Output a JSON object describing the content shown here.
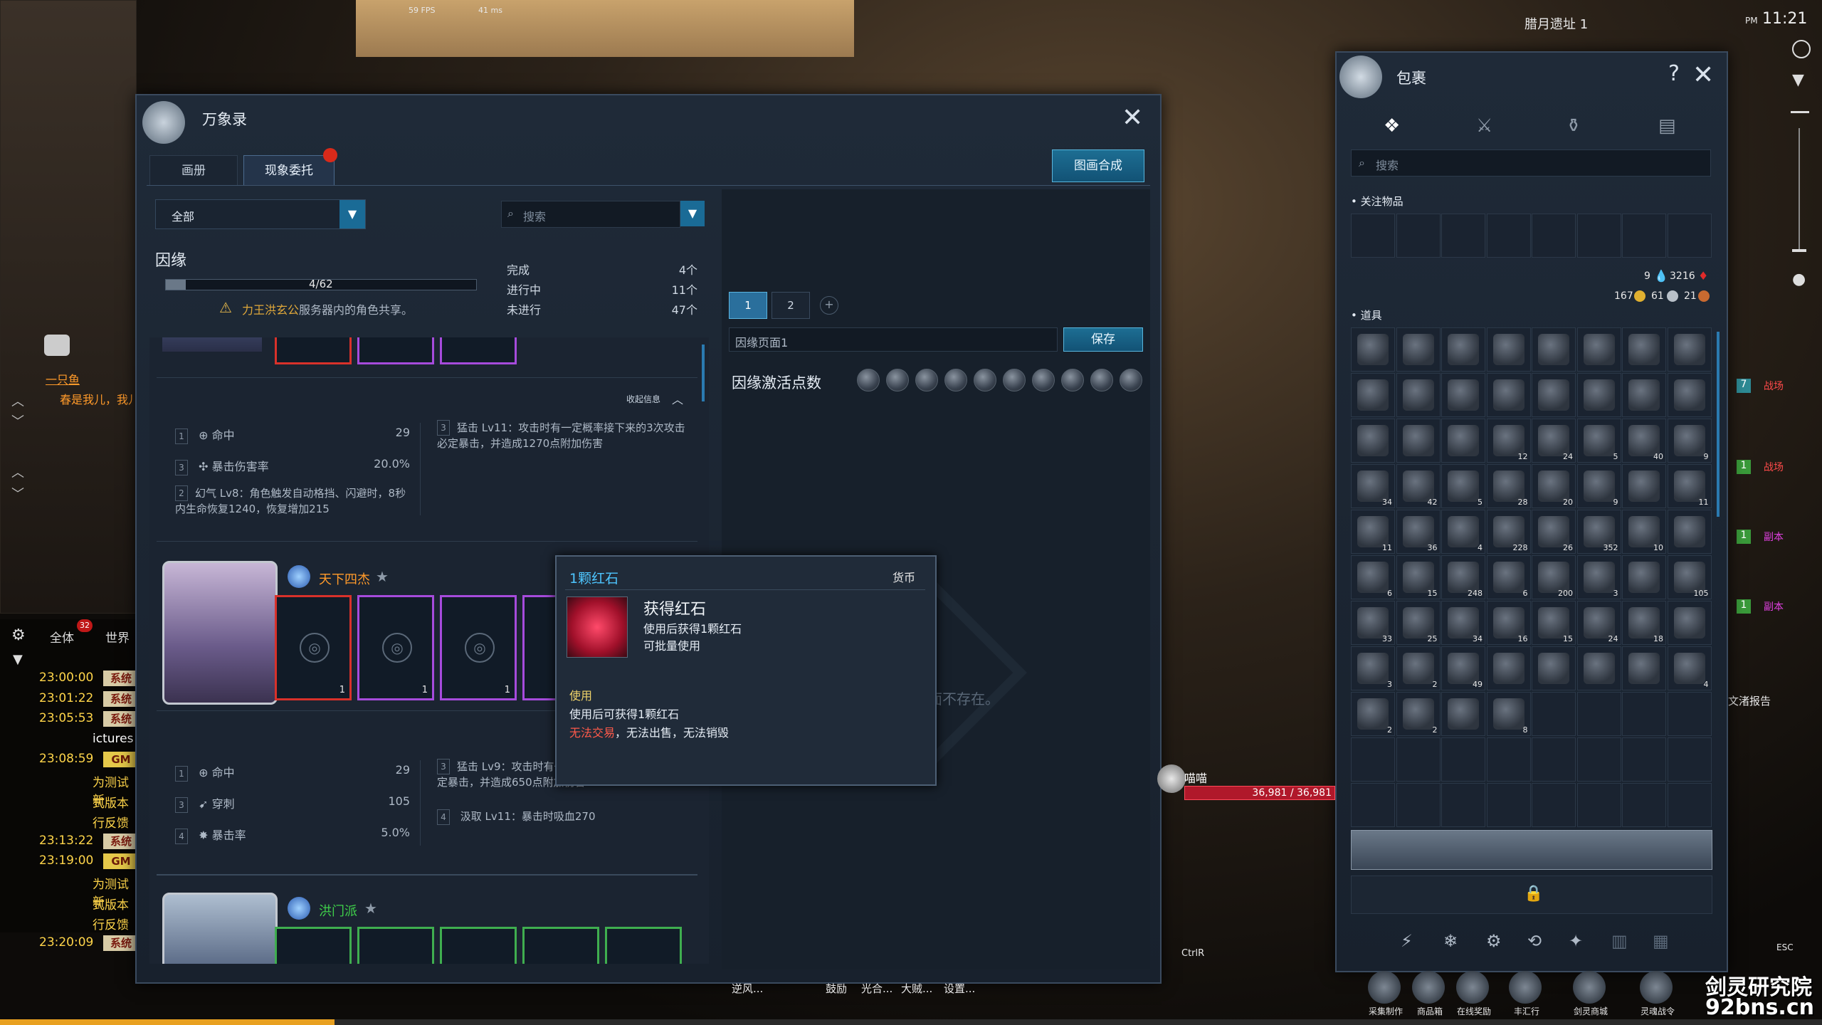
{
  "hud": {
    "fps": "59 FPS",
    "ping": "41 ms",
    "location": "腊月遗址 1",
    "time_prefix": "PM",
    "time": "11:21",
    "player_name": "喵喵",
    "hp": "36,981 / 36,981",
    "ctrl_hint": "CtrlR",
    "esc_hint": "ESC",
    "report_text": "文渚报告",
    "watermark": "剑灵研究院",
    "watermark_url": "92bns.cn",
    "right_zone_labels": [
      "战场",
      "战场",
      "副本",
      "副本"
    ],
    "right_zone_counts": [
      "7",
      "1",
      "1",
      "1"
    ],
    "left_name": "一只鱼",
    "left_msg": "春是我儿，我儿"
  },
  "chat": {
    "tabs": [
      "全体",
      "世界"
    ],
    "badge": "32",
    "rows": [
      {
        "time": "23:00:00",
        "tag": "系统"
      },
      {
        "time": "23:01:22",
        "tag": "系统"
      },
      {
        "time": "23:05:53",
        "tag": "系统"
      },
      {
        "time": "",
        "tag": "",
        "text": "ictures"
      },
      {
        "time": "23:08:59",
        "tag": "GM"
      },
      {
        "time": "",
        "tag": "",
        "text": "为测试新"
      },
      {
        "time": "",
        "tag": "",
        "text": "式版本"
      },
      {
        "time": "",
        "tag": "",
        "text": "行反馈"
      },
      {
        "time": "23:13:22",
        "tag": "系统"
      },
      {
        "time": "23:19:00",
        "tag": "GM"
      },
      {
        "time": "",
        "tag": "",
        "text": "为测试新"
      },
      {
        "time": "",
        "tag": "",
        "text": "式版本"
      },
      {
        "time": "",
        "tag": "",
        "text": "行反馈"
      },
      {
        "time": "23:20:09",
        "tag": "系统"
      }
    ]
  },
  "wanxiang": {
    "title": "万象录",
    "tabs": [
      "画册",
      "现象委托"
    ],
    "merge_button": "图画合成",
    "filter_value": "全部",
    "search_placeholder": "搜索",
    "section_title": "因缘",
    "progress": "4/62",
    "progress_fraction": 0.065,
    "warn_name": "力王洪玄公",
    "warn_suffix": "服务器内的角色共享。",
    "legend": [
      {
        "label": "完成",
        "count": "4个"
      },
      {
        "label": "进行中",
        "count": "11个"
      },
      {
        "label": "未进行",
        "count": "47个"
      }
    ],
    "collapse_label": "收起信息",
    "group1": {
      "stats": [
        {
          "lvl": "1",
          "name": "命中",
          "value": "29"
        },
        {
          "lvl": "3",
          "name": "暴击伤害率",
          "value": "20.0%"
        },
        {
          "lvl": "2",
          "name": "幻气 Lv8：角色触发自动格挡、闪避时，8秒内生命恢复1240，恢复增加215",
          "value": ""
        }
      ],
      "effects": [
        {
          "lvl": "3",
          "text": "猛击 Lv11：攻击时有一定概率接下来的3次攻击必定暴击，并造成1270点附加伤害"
        }
      ]
    },
    "group2": {
      "name": "天下四杰",
      "card_counts": [
        "1",
        "1",
        "1"
      ],
      "stats": [
        {
          "lvl": "1",
          "name": "命中",
          "value": "29"
        },
        {
          "lvl": "3",
          "name": "穿刺",
          "value": "105"
        },
        {
          "lvl": "4",
          "name": "暴击率",
          "value": "5.0%"
        }
      ],
      "effects": [
        {
          "lvl": "3",
          "text": "猛击 Lv9：攻击时有一定概率接下来的3次攻击必定暴击，并造成650点附加伤害"
        },
        {
          "lvl": "4",
          "text": "汲取 Lv11：暴击时吸血270"
        }
      ]
    },
    "group3": {
      "name": "洪门派"
    },
    "page_tabs": [
      "1",
      "2"
    ],
    "page_name": "因缘页面1",
    "save_button": "保存",
    "activate_label": "因缘激活点数",
    "empty_text": "搜索的页面不存在。"
  },
  "tooltip": {
    "title": "1颗红石",
    "type": "货币",
    "item_name": "获得红石",
    "line1": "使用后获得1颗红石",
    "line2": "可批量使用",
    "use_header": "使用",
    "use_desc": "使用后可获得1颗红石",
    "restrict_red": "无法交易",
    "restrict_rest": "，无法出售，无法销毁"
  },
  "inventory": {
    "title": "包裹",
    "help": "?",
    "search_placeholder": "搜索",
    "watch_label": "关注物品",
    "items_label": "道具",
    "currency": {
      "a": "9",
      "b": "3216",
      "gold": "167",
      "silver": "61",
      "copper": "21"
    },
    "counts": [
      "",
      "",
      "",
      "",
      "",
      "",
      "",
      "",
      "",
      "",
      "",
      "",
      "",
      "",
      "",
      "",
      "",
      "",
      "",
      "12",
      "24",
      "5",
      "40",
      "9",
      "34",
      "42",
      "5",
      "28",
      "20",
      "9",
      "",
      "11",
      "11",
      "36",
      "4",
      "228",
      "26",
      "352",
      "10",
      "",
      "6",
      "15",
      "248",
      "6",
      "200",
      "3",
      "",
      "105",
      "33",
      "25",
      "34",
      "16",
      "15",
      "24",
      "18",
      "",
      "3",
      "2",
      "49",
      "",
      "",
      "",
      "",
      "4",
      "2",
      "2",
      "",
      "8",
      "",
      "",
      "",
      ""
    ],
    "filled": 68
  },
  "bottom_bar": {
    "skills": [
      "逆风...",
      "鼓励",
      "光合...",
      "大贼...",
      "设置..."
    ],
    "icons": [
      "采集制作",
      "商品箱",
      "在线奖励",
      "丰汇行",
      "剑灵商城",
      "灵魂战令"
    ]
  }
}
